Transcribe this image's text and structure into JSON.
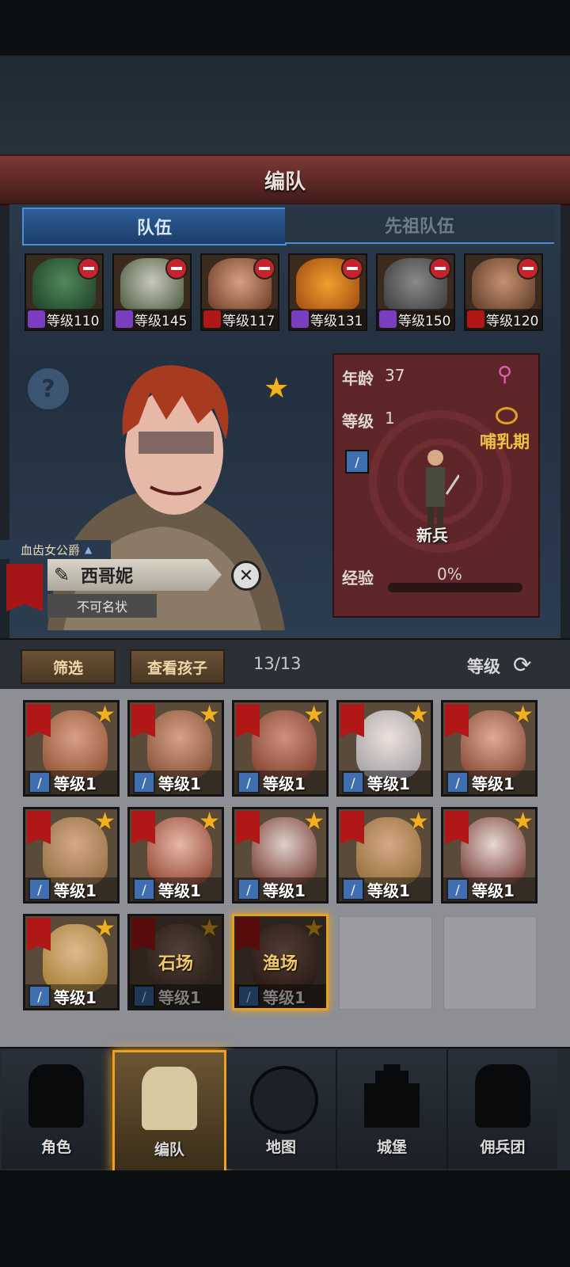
{
  "screen_title": "编队",
  "tabs": [
    {
      "label": "队伍",
      "active": true
    },
    {
      "label": "先祖队伍",
      "active": false
    }
  ],
  "team": [
    {
      "level": "等级110",
      "class_icon": "staff-icon"
    },
    {
      "level": "等级145",
      "class_icon": "staff-icon"
    },
    {
      "level": "等级117",
      "class_icon": "horse-icon"
    },
    {
      "level": "等级131",
      "class_icon": "staff-icon"
    },
    {
      "level": "等级150",
      "class_icon": "staff-icon"
    },
    {
      "level": "等级120",
      "class_icon": "horse-icon"
    }
  ],
  "hero": {
    "age_label": "年龄",
    "age": "37",
    "gender_icon": "female-icon",
    "level_label": "等级",
    "level": "1",
    "trait_icon": "rings-icon",
    "trait": "哺乳期",
    "class_icon": "sword-icon",
    "rank": "新兵",
    "exp_label": "经验",
    "exp": "0%",
    "title": "血齿女公爵",
    "name": "西哥妮",
    "epithet": "不可名状"
  },
  "toolbar": {
    "filter": "筛选",
    "view_children": "查看孩子",
    "count": "13/13",
    "sort": "等级"
  },
  "roster": [
    {
      "level": "等级1"
    },
    {
      "level": "等级1"
    },
    {
      "level": "等级1"
    },
    {
      "level": "等级1"
    },
    {
      "level": "等级1"
    },
    {
      "level": "等级1"
    },
    {
      "level": "等级1"
    },
    {
      "level": "等级1"
    },
    {
      "level": "等级1"
    },
    {
      "level": "等级1"
    },
    {
      "level": "等级1"
    },
    {
      "level": "等级1",
      "job": "石场"
    },
    {
      "level": "等级1",
      "job": "渔场"
    }
  ],
  "nav": [
    {
      "label": "角色",
      "icon": "knight-icon"
    },
    {
      "label": "编队",
      "icon": "helmet-icon",
      "active": true
    },
    {
      "label": "地图",
      "icon": "compass-map-icon"
    },
    {
      "label": "城堡",
      "icon": "castle-icon"
    },
    {
      "label": "佣兵团",
      "icon": "mercenary-icon"
    }
  ],
  "colors": {
    "accent_gold": "#f0a020",
    "tab_blue": "#2e5f99",
    "banner_red": "#5a2624",
    "faction_red": "#b01818"
  }
}
